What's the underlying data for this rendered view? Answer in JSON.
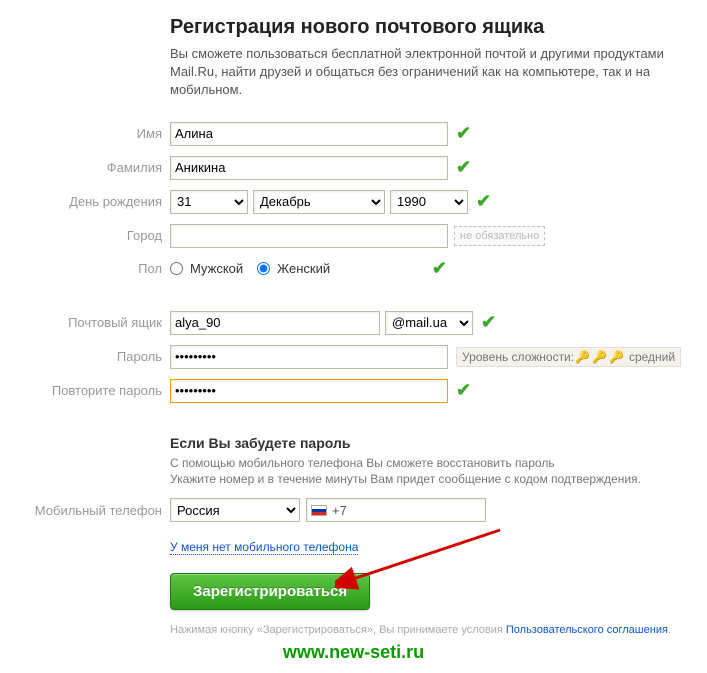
{
  "heading": "Регистрация нового почтового ящика",
  "subdesc": "Вы сможете пользоваться бесплатной электронной почтой и другими продуктами Mail.Ru, найти друзей и общаться без ограничений как на компьютере, так и на мобильном.",
  "labels": {
    "firstname": "Имя",
    "lastname": "Фамилия",
    "birthday": "День рождения",
    "city": "Город",
    "gender": "Пол",
    "mailbox": "Почтовый ящик",
    "password": "Пароль",
    "repassword": "Повторите пароль",
    "mobile": "Мобильный телефон"
  },
  "values": {
    "firstname": "Алина",
    "lastname": "Аникина",
    "day": "31",
    "month": "Декабрь",
    "year": "1990",
    "city": "",
    "mailbox_user": "alya_90",
    "mailbox_domain": "@mail.ua",
    "password": "•••••••••",
    "repassword": "•••••••••",
    "country": "Россия",
    "phone_prefix": "+7"
  },
  "gender": {
    "male": "Мужской",
    "female": "Женский",
    "selected": "female"
  },
  "optional_tag": "не обязательно",
  "password_meter": {
    "label": "Уровень сложности:",
    "level_text": "средний",
    "keys_on": 2,
    "keys_total": 3
  },
  "forgot": {
    "heading": "Если Вы забудете пароль",
    "line1": "С помощью мобильного телефона Вы сможете восстановить пароль",
    "line2": "Укажите номер и в течение минуты Вам придет сообщение с кодом подтверждения."
  },
  "no_phone_link": "У меня нет мобильного телефона",
  "register_button": "Зарегистрироваться",
  "footnote": {
    "pre": "Нажимая кнопку «Зарегистрироваться», Вы принимаете условия ",
    "link": "Пользовательского соглашения",
    "post": "."
  },
  "watermark": "www.new-seti.ru"
}
